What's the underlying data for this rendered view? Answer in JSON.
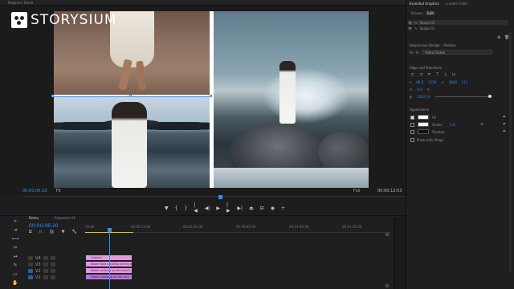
{
  "monitor": {
    "panel_label": "Program: Demo",
    "current_time": "00:00:06:20",
    "fit": "Fit",
    "quality": "Full",
    "duration": "00:00:12:03",
    "logo_text": "STORYSIUM"
  },
  "transport": {
    "icons": [
      "marker-icon",
      "in-icon",
      "out-icon",
      "go-in-icon",
      "step-back-icon",
      "play-icon",
      "step-forward-icon",
      "go-out-icon",
      "lift-icon",
      "extract-icon",
      "export-frame-icon",
      "button-editor-icon"
    ]
  },
  "timeline": {
    "tab_active": "Demo",
    "tab_other": "Sequence 01",
    "timecode": "00:00:06:20",
    "ruler_labels": [
      "00:00",
      "00:00:15:00",
      "00:00:30:00",
      "00:00:45:00",
      "00:01:00:00",
      "00:01:15:00"
    ],
    "clips": [
      {
        "label": "Graphic",
        "color": "pink"
      },
      {
        "label": "Model fade awaiting on the beach",
        "color": "pink"
      },
      {
        "label": "Model walking on the beach",
        "color": "pink"
      },
      {
        "label": "Model standing on the rock",
        "color": "purple"
      }
    ],
    "tracks": [
      "V4",
      "V3",
      "V2",
      "V1"
    ]
  },
  "essential_graphics": {
    "title": "Essential Graphics",
    "other_tab": "Lumetri Color",
    "subtabs": [
      "Browse",
      "Edit"
    ],
    "layers": [
      "Shape 02",
      "Shape 01"
    ],
    "responsive_label": "Responsive Design – Position",
    "pin_to_label": "Pin To:",
    "pin_to_value": "Video Frame",
    "align_label": "Align and Transform",
    "pos_x": "96.0",
    "pos_y": "1150",
    "rot": "0.0",
    "opacity": "100.0 %",
    "size_w": "1840",
    "size_h": "112",
    "appearance_label": "Appearance",
    "fill_label": "Fill",
    "stroke_label": "Stroke",
    "shadow_label": "Shadow",
    "stroke_value": "1.0",
    "mask_label": "Mask with Shape"
  },
  "colors": {
    "accent": "#2f8cff",
    "clip_pink": "#e39ae3",
    "clip_purple": "#b27ad6",
    "workarea": "#d3c35a"
  }
}
